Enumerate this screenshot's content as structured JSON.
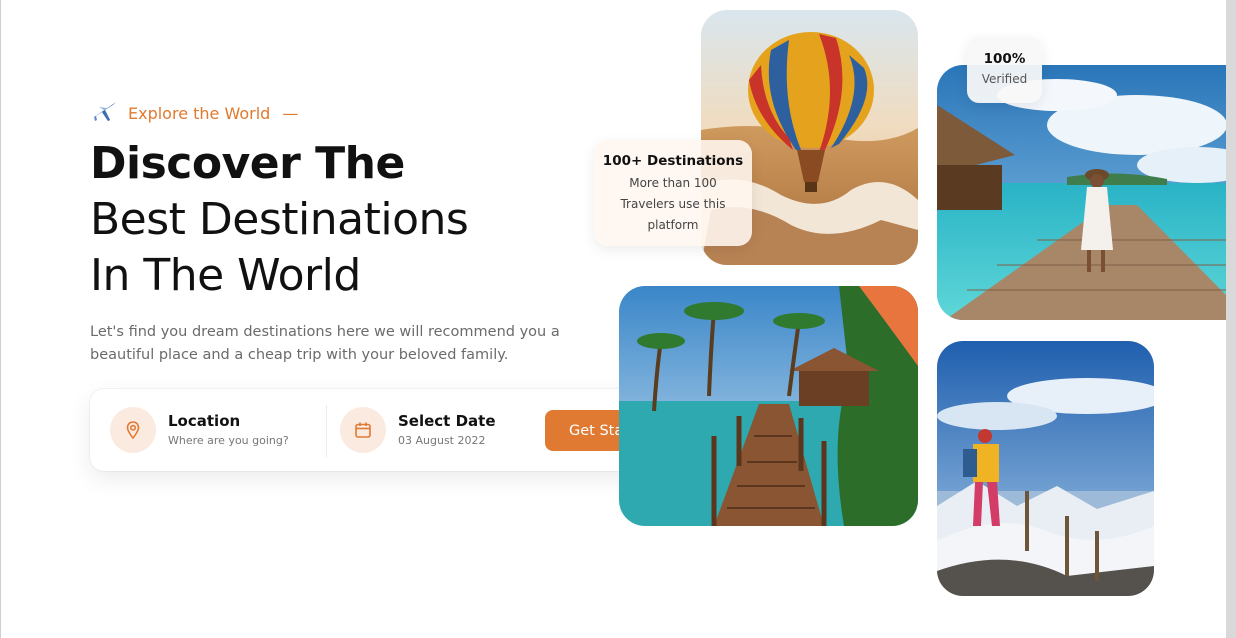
{
  "hero": {
    "eyebrow": "Explore the World",
    "eyebrow_dash": "—",
    "title_line1": "Discover The",
    "title_line2": "Best Destinations",
    "title_line3": "In The World",
    "subtitle": "Let's find you dream destinations here we will recommend you a beautiful place and a cheap trip with your beloved family."
  },
  "search": {
    "location_label": "Location",
    "location_sub": "Where are you going?",
    "date_label": "Select Date",
    "date_sub": "03 August 2022",
    "cta_label": "Get Started"
  },
  "badges": {
    "destinations_title": "100+ Destinations",
    "destinations_body": "More than 100 Travelers use this platform",
    "verified_title": "100%",
    "verified_sub": "Verified"
  },
  "icons": {
    "eyebrow": "airplane-icon",
    "location": "map-pin-icon",
    "date": "calendar-icon"
  },
  "colors": {
    "accent": "#e07a33",
    "accent_soft": "#fbeae0",
    "text_primary": "#111111",
    "text_muted": "#6b6b6b"
  }
}
